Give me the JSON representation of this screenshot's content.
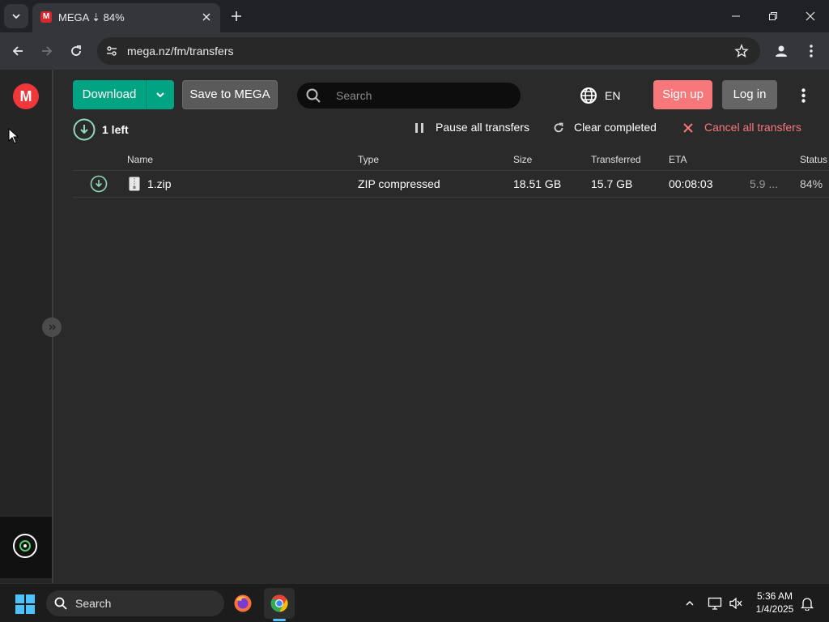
{
  "browser": {
    "tab_title": "MEGA ⇣ 84%",
    "favicon_letter": "M",
    "url": "mega.nz/fm/transfers"
  },
  "header": {
    "download_label": "Download",
    "save_label": "Save to MEGA",
    "search_placeholder": "Search",
    "language": "EN",
    "signup_label": "Sign up",
    "login_label": "Log in"
  },
  "transfers": {
    "remaining": "1 left",
    "pause_all": "Pause all transfers",
    "clear_completed": "Clear completed",
    "cancel_all": "Cancel all transfers",
    "columns": [
      "Name",
      "Type",
      "Size",
      "Transferred",
      "ETA",
      "Status"
    ],
    "rows": [
      {
        "name": "1.zip",
        "type": "ZIP compressed",
        "size": "18.51 GB",
        "transferred": "15.7 GB",
        "eta": "00:08:03",
        "speed": "5.9 ...",
        "status": "84%"
      }
    ]
  },
  "taskbar": {
    "search_label": "Search",
    "time": "5:36 AM",
    "date": "1/4/2025"
  },
  "colors": {
    "accent_green": "#00a382",
    "signup_red": "#f7777a",
    "cancel_red": "#f7777a",
    "mega_red": "#f0373a"
  }
}
